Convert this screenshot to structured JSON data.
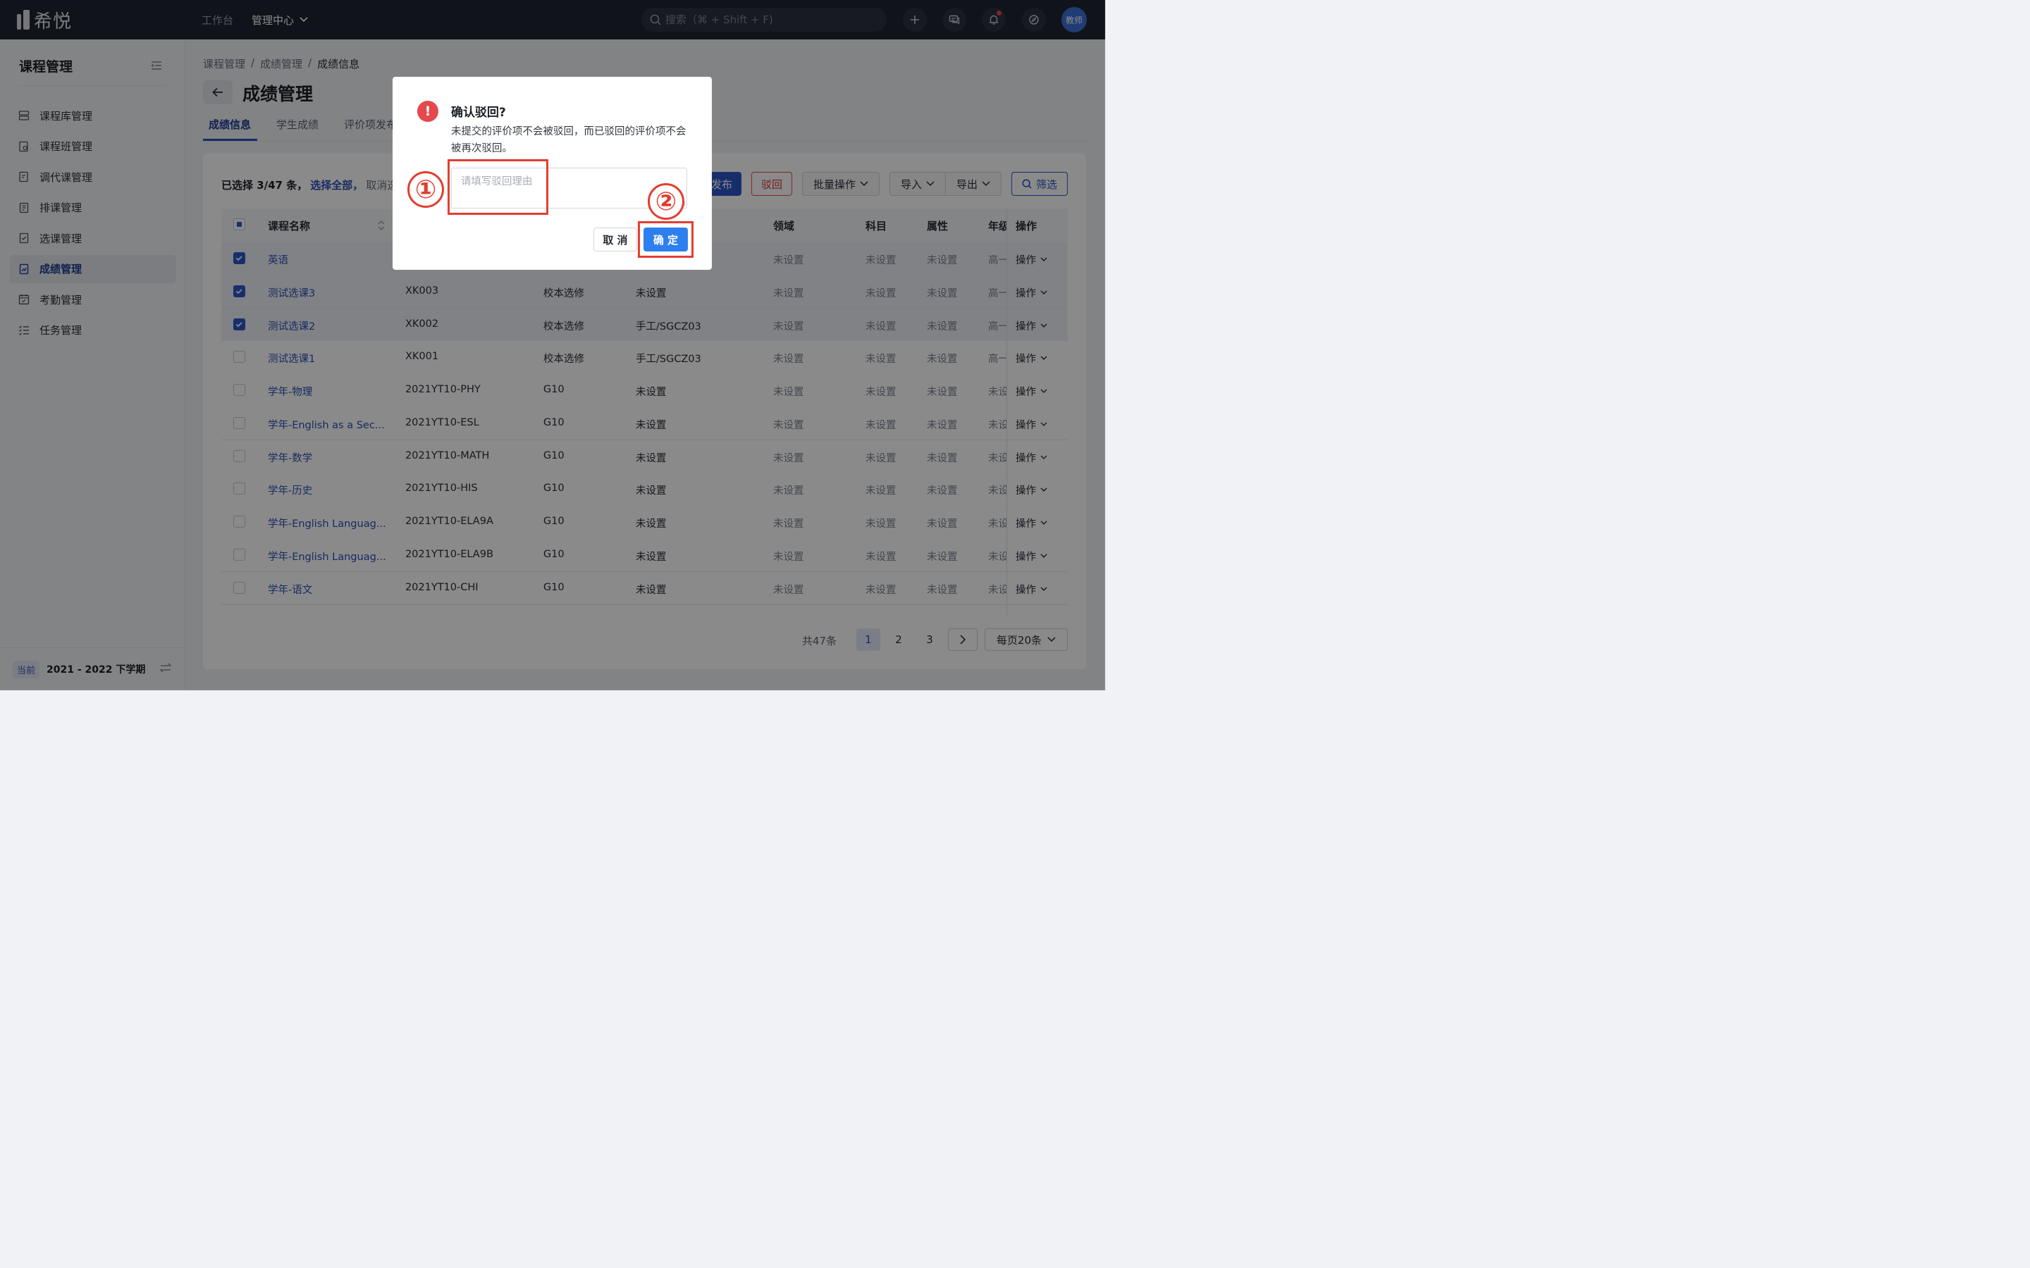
{
  "app": {
    "logo": "希悦"
  },
  "topnav": {
    "workbench": "工作台",
    "admin": "管理中心"
  },
  "search": {
    "placeholder": "搜索（⌘ + Shift + F)"
  },
  "user": {
    "avatar": "教师"
  },
  "sidebar": {
    "title": "课程管理",
    "items": [
      {
        "label": "课程库管理",
        "icon": "library-icon"
      },
      {
        "label": "课程班管理",
        "icon": "class-icon"
      },
      {
        "label": "调代课管理",
        "icon": "substitute-icon"
      },
      {
        "label": "排课管理",
        "icon": "schedule-icon"
      },
      {
        "label": "选课管理",
        "icon": "selection-icon"
      },
      {
        "label": "成绩管理",
        "icon": "grade-icon"
      },
      {
        "label": "考勤管理",
        "icon": "attendance-icon"
      },
      {
        "label": "任务管理",
        "icon": "task-icon"
      }
    ],
    "footer": {
      "tag": "当前",
      "term": "2021 - 2022 下学期"
    }
  },
  "breadcrumb": [
    "课程管理",
    "成绩管理",
    "成绩信息"
  ],
  "page": {
    "title": "成绩管理"
  },
  "tabs": [
    "成绩信息",
    "学生成绩",
    "评价项发布"
  ],
  "toolbar": {
    "selected_prefix": "已选择 3/47 条，",
    "select_all": "选择全部，",
    "cancel_select": "取消选择",
    "publish": "发布",
    "reject": "驳回",
    "batch": "批量操作",
    "import": "导入",
    "export": "导出",
    "filter": "筛选"
  },
  "table": {
    "headers": {
      "name": "课程名称",
      "domain": "领域",
      "subject": "科目",
      "attr": "属性",
      "grade": "年级",
      "op": "操作"
    },
    "rows": [
      {
        "name": "英语",
        "code": "",
        "type": "",
        "tag": "",
        "domain": "未设置",
        "subject": "未设置",
        "attr": "未设置",
        "grade": "高一",
        "op": "操作",
        "selected": true
      },
      {
        "name": "测试选课3",
        "code": "XK003",
        "type": "校本选修",
        "tag": "未设置",
        "domain": "未设置",
        "subject": "未设置",
        "attr": "未设置",
        "grade": "高一",
        "op": "操作",
        "selected": true
      },
      {
        "name": "测试选课2",
        "code": "XK002",
        "type": "校本选修",
        "tag": "手工/SGCZ03",
        "domain": "未设置",
        "subject": "未设置",
        "attr": "未设置",
        "grade": "高一",
        "op": "操作",
        "selected": true
      },
      {
        "name": "测试选课1",
        "code": "XK001",
        "type": "校本选修",
        "tag": "手工/SGCZ03",
        "domain": "未设置",
        "subject": "未设置",
        "attr": "未设置",
        "grade": "高一",
        "op": "操作",
        "selected": false
      },
      {
        "name": "学年-物理",
        "code": "2021YT10-PHY",
        "type": "G10",
        "tag": "未设置",
        "domain": "未设置",
        "subject": "未设置",
        "attr": "未设置",
        "grade": "未设",
        "op": "操作",
        "selected": false
      },
      {
        "name": "学年-English as a Sec...",
        "code": "2021YT10-ESL",
        "type": "G10",
        "tag": "未设置",
        "domain": "未设置",
        "subject": "未设置",
        "attr": "未设置",
        "grade": "未设",
        "op": "操作",
        "selected": false
      },
      {
        "name": "学年-数学",
        "code": "2021YT10-MATH",
        "type": "G10",
        "tag": "未设置",
        "domain": "未设置",
        "subject": "未设置",
        "attr": "未设置",
        "grade": "未设",
        "op": "操作",
        "selected": false
      },
      {
        "name": "学年-历史",
        "code": "2021YT10-HIS",
        "type": "G10",
        "tag": "未设置",
        "domain": "未设置",
        "subject": "未设置",
        "attr": "未设置",
        "grade": "未设",
        "op": "操作",
        "selected": false
      },
      {
        "name": "学年-English Languag...",
        "code": "2021YT10-ELA9A",
        "type": "G10",
        "tag": "未设置",
        "domain": "未设置",
        "subject": "未设置",
        "attr": "未设置",
        "grade": "未设",
        "op": "操作",
        "selected": false
      },
      {
        "name": "学年-English Languag...",
        "code": "2021YT10-ELA9B",
        "type": "G10",
        "tag": "未设置",
        "domain": "未设置",
        "subject": "未设置",
        "attr": "未设置",
        "grade": "未设",
        "op": "操作",
        "selected": false
      },
      {
        "name": "学年-语文",
        "code": "2021YT10-CHI",
        "type": "G10",
        "tag": "未设置",
        "domain": "未设置",
        "subject": "未设置",
        "attr": "未设置",
        "grade": "未设",
        "op": "操作",
        "selected": false
      }
    ]
  },
  "pagination": {
    "total": "共47条",
    "pages": [
      "1",
      "2",
      "3"
    ],
    "current": "1",
    "page_size": "每页20条"
  },
  "dialog": {
    "title": "确认驳回?",
    "text": "未提交的评价项不会被驳回，而已驳回的评价项不会被再次驳回。",
    "placeholder": "请填写驳回理由",
    "cancel": "取 消",
    "ok": "确 定"
  },
  "annotations": [
    "①",
    "②"
  ],
  "colors": {
    "accent": "#2d56c8",
    "danger": "#e5484d",
    "annotation": "#e23d2f"
  }
}
